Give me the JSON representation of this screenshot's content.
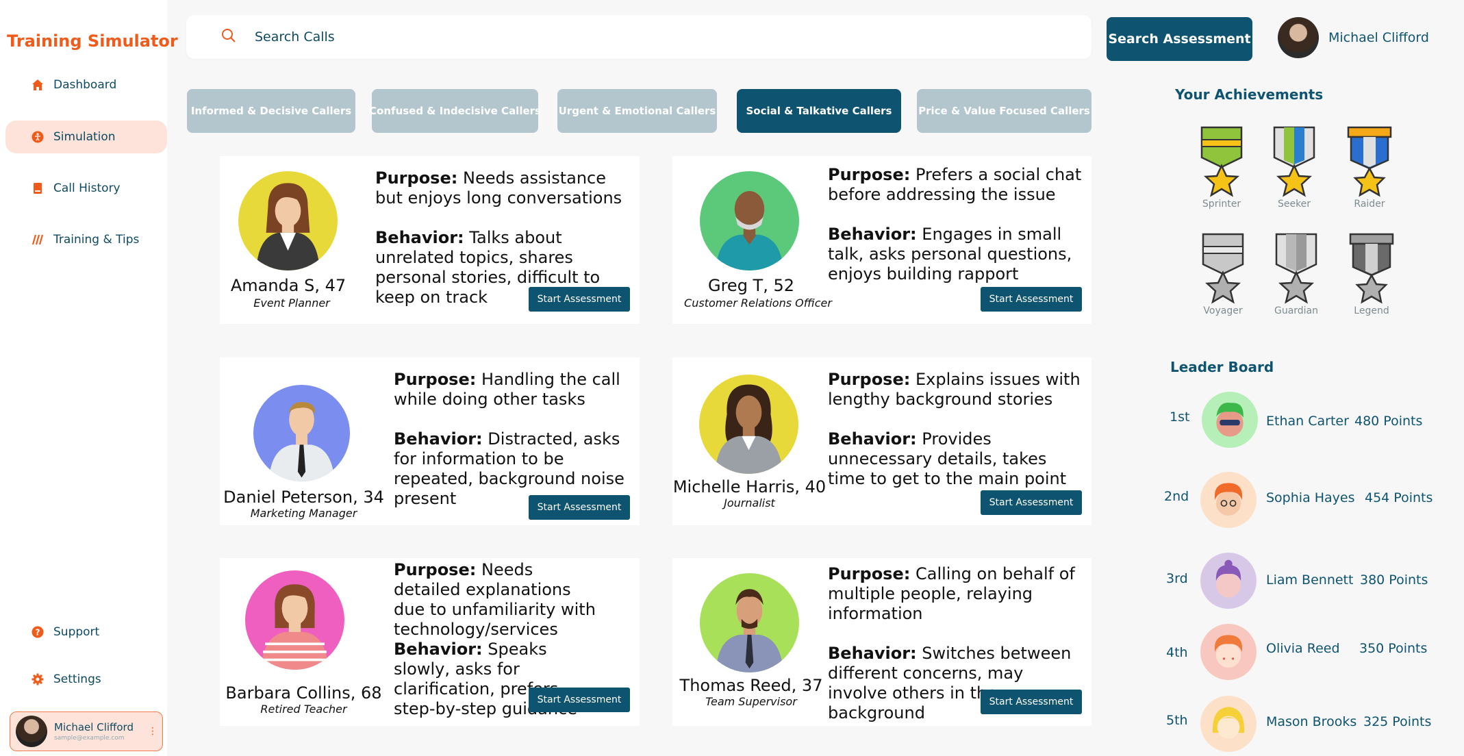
{
  "app": {
    "brand": "Training Simulator"
  },
  "sidebar": {
    "items": [
      {
        "label": "Dashboard",
        "icon": "home-icon"
      },
      {
        "label": "Simulation",
        "icon": "person-icon"
      },
      {
        "label": "Call History",
        "icon": "book-icon"
      },
      {
        "label": "Training & Tips",
        "icon": "stripes-icon"
      }
    ],
    "bottom": [
      {
        "label": "Support",
        "icon": "question-icon"
      },
      {
        "label": "Settings",
        "icon": "gear-icon"
      }
    ],
    "user": {
      "name": "Michael Clifford",
      "email": "sample@example.com"
    }
  },
  "search": {
    "placeholder": "Search Calls"
  },
  "header": {
    "search_button": "Search Assessment",
    "user_name": "Michael Clifford"
  },
  "tabs": [
    {
      "label": "Informed & Decisive Callers"
    },
    {
      "label": "Confused & Indecisive Callers"
    },
    {
      "label": "Urgent & Emotional Callers"
    },
    {
      "label": "Social & Talkative Callers"
    },
    {
      "label": "Price & Value Focused Callers"
    }
  ],
  "labels": {
    "purpose": "Purpose:",
    "behavior": "Behavior:",
    "start": "Start Assessment"
  },
  "callers": [
    {
      "name": "Amanda S, 47",
      "role": "Event Planner",
      "purpose": "Needs assistance but enjoys long conversations",
      "behavior": "Talks about unrelated topics, shares personal stories, difficult to keep on track"
    },
    {
      "name": "Greg T, 52",
      "role": "Customer Relations Officer",
      "purpose": "Prefers a social chat before addressing the issue",
      "behavior": "Engages in small talk, asks personal questions, enjoys building rapport"
    },
    {
      "name": "Daniel Peterson, 34",
      "role": "Marketing Manager",
      "purpose": "Handling the call while doing other tasks",
      "behavior": "Distracted, asks for information to be repeated, background noise present"
    },
    {
      "name": "Michelle Harris, 40",
      "role": "Journalist",
      "purpose": "Explains issues with lengthy background stories",
      "behavior": "Provides unnecessary details, takes time to get to the main point"
    },
    {
      "name": "Barbara Collins, 68",
      "role": "Retired Teacher",
      "purpose": "Needs detailed explanations due to unfamiliarity with technology/services",
      "behavior": "Speaks slowly, asks for clarification, prefers step-by-step guidance"
    },
    {
      "name": "Thomas Reed, 37",
      "role": "Team Supervisor",
      "purpose": "Calling on behalf of multiple people, relaying information",
      "behavior": "Switches between different concerns, may involve others in the background"
    }
  ],
  "achievements": {
    "title": "Your Achievements",
    "medals": [
      {
        "label": "Sprinter"
      },
      {
        "label": "Seeker"
      },
      {
        "label": "Raider"
      },
      {
        "label": "Voyager"
      },
      {
        "label": "Guardian"
      },
      {
        "label": "Legend"
      }
    ]
  },
  "leaderboard": {
    "title": "Leader Board",
    "rows": [
      {
        "rank": "1st",
        "name": "Ethan Carter",
        "points": "480 Points"
      },
      {
        "rank": "2nd",
        "name": "Sophia Hayes",
        "points": "454 Points"
      },
      {
        "rank": "3rd",
        "name": "Liam Bennett",
        "points": "380 Points"
      },
      {
        "rank": "4th",
        "name": "Olivia Reed",
        "points": "350 Points"
      },
      {
        "rank": "5th",
        "name": "Mason Brooks",
        "points": "325 Points"
      }
    ]
  },
  "colors": {
    "brand": "#f05a1a",
    "primary": "#0e5470",
    "tab_inactive": "#b4c6cd",
    "active_nav": "#fde3d9"
  }
}
